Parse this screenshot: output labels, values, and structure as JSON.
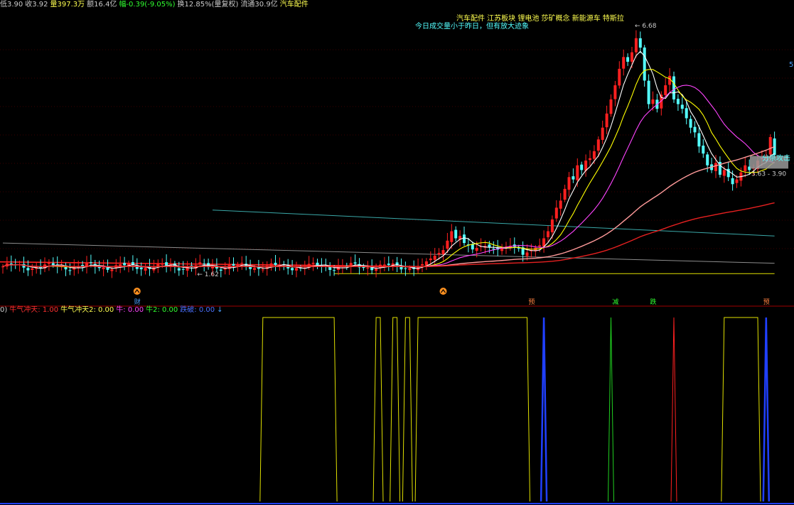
{
  "header": {
    "low_label": "低3.90",
    "close_label": "收3.92",
    "vol_label": "量397.3万",
    "amount_label": "额16.4亿",
    "change_label": "幅-0.39(-9.05%)",
    "turnover_label": "换12.85%(量复权)",
    "float_label": "流通30.9亿",
    "sector_label": "汽车配件"
  },
  "concepts": "汽车配件 江苏板块 锂电池 莎矿概念 新能源车 特斯拉",
  "volume_note": "今日成交量小于昨日，但有放大迹象",
  "right_edge_label": "5",
  "zone_label": "分杀攻击",
  "indicator_header": {
    "prefix": "0)",
    "s1": "牛气冲天: 1.00",
    "s2": "牛气冲天2: 0.00",
    "s3": "牛: 0.00",
    "s4": "牛2: 0.00",
    "s5": "跌破: 0.00",
    "arrow": "↓"
  },
  "colors": {
    "up": "#ff2020",
    "down": "#54ffff",
    "ma5": "#ffffff",
    "ma10": "#ffff00",
    "ma20": "#ff44ff",
    "ma60": "#ff9a9a",
    "ma120": "#e62020",
    "grid": "#7a0000"
  },
  "chart_data": {
    "type": "candlestick",
    "high_label": "6.68",
    "low_label": "1.62",
    "range_label": "3.63 - 3.90",
    "event_markers": [
      {
        "bar": 32,
        "text": "财",
        "color": "#4aa0ff"
      },
      {
        "bar": 126,
        "text": "预",
        "color": "#ff8040"
      },
      {
        "bar": 146,
        "text": "减",
        "color": "#30ff30"
      },
      {
        "bar": 155,
        "text": "跌",
        "color": "#30ff30"
      },
      {
        "bar": 182,
        "text": "预",
        "color": "#ff8040"
      }
    ],
    "signal_arrows": [
      32,
      105
    ],
    "trendlines": [
      {
        "color": "#3aa8a8",
        "from": [
          50,
          2.75
        ],
        "to": [
          184,
          2.2
        ]
      },
      {
        "color": "#8c8c8c",
        "from": [
          0,
          2.05
        ],
        "to": [
          184,
          1.62
        ]
      },
      {
        "color": "#e0e000",
        "from": [
          79,
          1.4
        ],
        "to": [
          184,
          1.4
        ]
      }
    ],
    "indicator": {
      "series_names": [
        "牛气冲天",
        "牛气冲天2",
        "牛",
        "牛2",
        "跌破"
      ],
      "yellow_high_ranges": [
        [
          62,
          79
        ],
        [
          89,
          90
        ],
        [
          93,
          94
        ],
        [
          96,
          97
        ],
        [
          99,
          125
        ],
        [
          172,
          180
        ]
      ],
      "blue_spikes": [
        129,
        182
      ],
      "green_spikes": [
        145
      ],
      "red_spikes": [
        160
      ]
    }
  }
}
